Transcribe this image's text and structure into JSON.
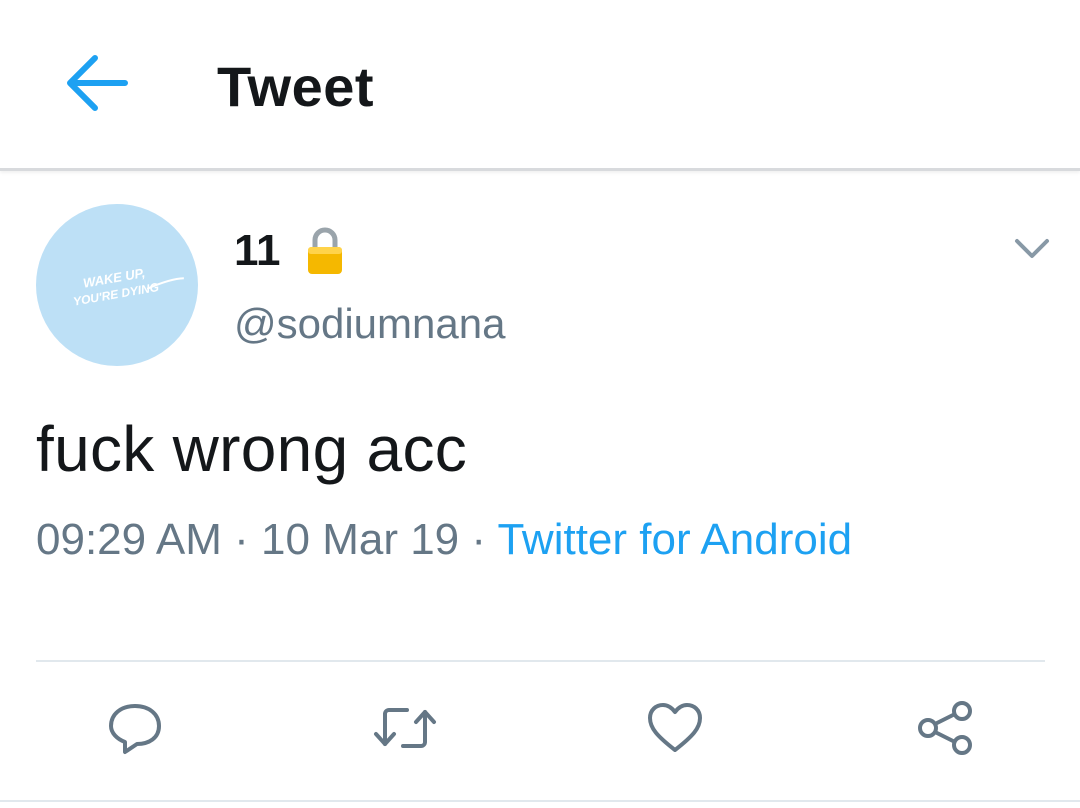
{
  "header": {
    "title": "Tweet",
    "back_icon": "arrow-left-icon"
  },
  "tweet": {
    "avatar": {
      "text_line1": "WAKE UP,",
      "text_line2": "YOU'RE DYING",
      "color": "#bde0f6"
    },
    "display_name": "11",
    "protected_icon": "lock-icon",
    "handle": "@sodiumnana",
    "more_icon": "chevron-down-icon",
    "text": "fuck wrong acc",
    "time": "09:29 AM",
    "separator": "·",
    "date": "10 Mar 19",
    "source": "Twitter for Android"
  },
  "actions": [
    {
      "name": "reply",
      "icon": "comment-icon"
    },
    {
      "name": "retweet",
      "icon": "retweet-icon"
    },
    {
      "name": "like",
      "icon": "heart-icon"
    },
    {
      "name": "share",
      "icon": "share-icon"
    }
  ],
  "colors": {
    "accent": "#1da1f2",
    "text_primary": "#14171a",
    "text_secondary": "#657786",
    "icon_gray": "#657786",
    "divider": "#e1e8ed"
  }
}
